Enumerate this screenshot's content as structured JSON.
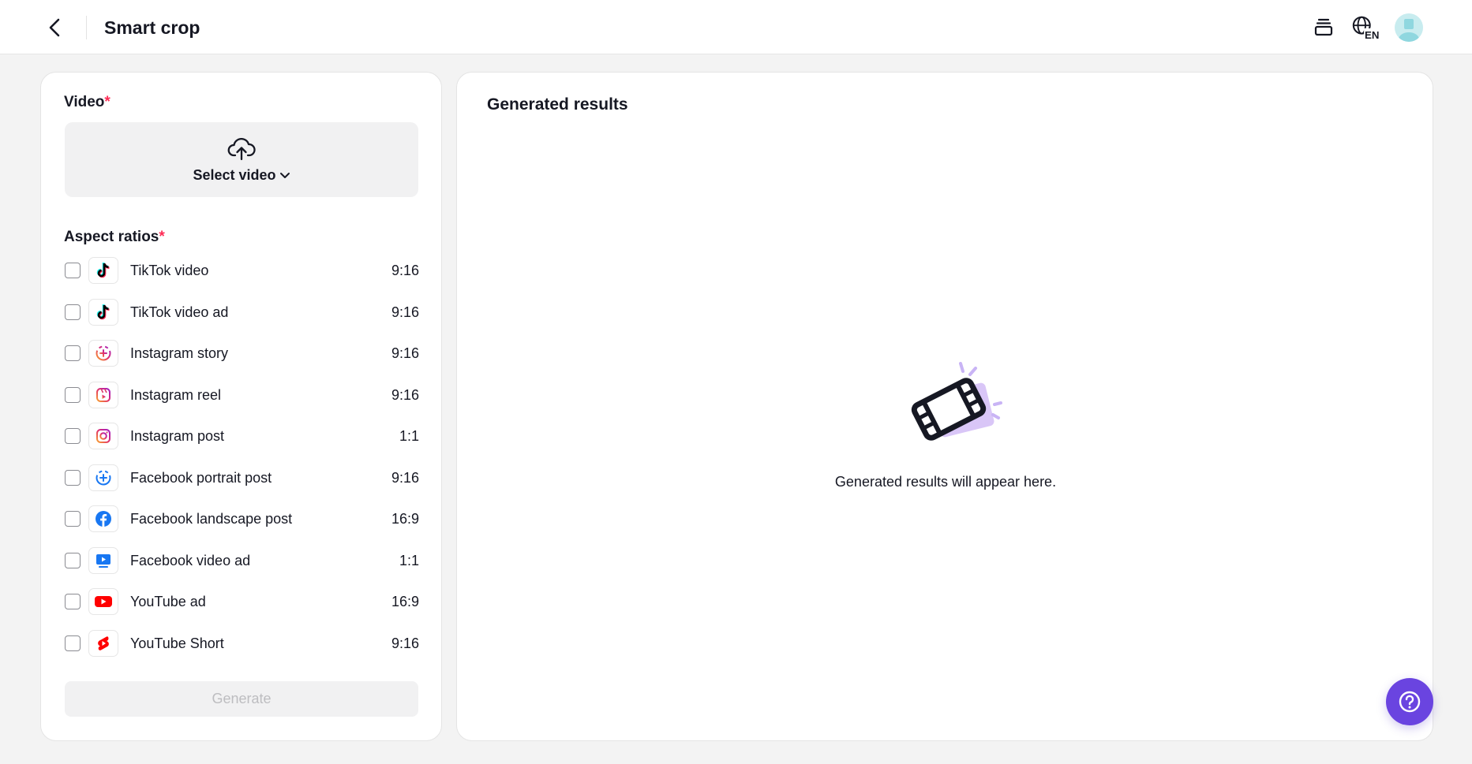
{
  "header": {
    "title": "Smart crop",
    "back_icon": "chevron-left-icon",
    "layers_icon": "layers-icon",
    "language_icon": "globe-icon",
    "language_code": "EN",
    "avatar_icon": "user-avatar"
  },
  "left_panel": {
    "video_label": "Video",
    "required_mark": "*",
    "upload": {
      "icon": "cloud-upload-icon",
      "label": "Select video",
      "chevron": "chevron-down-icon"
    },
    "aspect_ratios_label": "Aspect ratios",
    "ratios": [
      {
        "name": "TikTok video",
        "ratio": "9:16",
        "icon": "tiktok-icon",
        "checked": false
      },
      {
        "name": "TikTok video ad",
        "ratio": "9:16",
        "icon": "tiktok-icon",
        "checked": false
      },
      {
        "name": "Instagram story",
        "ratio": "9:16",
        "icon": "instagram-story-icon",
        "checked": false
      },
      {
        "name": "Instagram reel",
        "ratio": "9:16",
        "icon": "instagram-reel-icon",
        "checked": false
      },
      {
        "name": "Instagram post",
        "ratio": "1:1",
        "icon": "instagram-icon",
        "checked": false
      },
      {
        "name": "Facebook portrait post",
        "ratio": "9:16",
        "icon": "facebook-story-icon",
        "checked": false
      },
      {
        "name": "Facebook landscape post",
        "ratio": "16:9",
        "icon": "facebook-icon",
        "checked": false
      },
      {
        "name": "Facebook video ad",
        "ratio": "1:1",
        "icon": "facebook-video-icon",
        "checked": false
      },
      {
        "name": "YouTube ad",
        "ratio": "16:9",
        "icon": "youtube-icon",
        "checked": false
      },
      {
        "name": "YouTube Short",
        "ratio": "9:16",
        "icon": "youtube-shorts-icon",
        "checked": false
      }
    ],
    "generate_label": "Generate"
  },
  "right_panel": {
    "title": "Generated results",
    "empty_icon": "film-strip-icon",
    "empty_message": "Generated results will appear here."
  },
  "help": {
    "icon": "question-circle-icon"
  },
  "colors": {
    "accent": "#6a44e0",
    "required": "#fe2c55",
    "page_bg": "#f3f3f3",
    "disabled_text": "#bdbdc0"
  }
}
